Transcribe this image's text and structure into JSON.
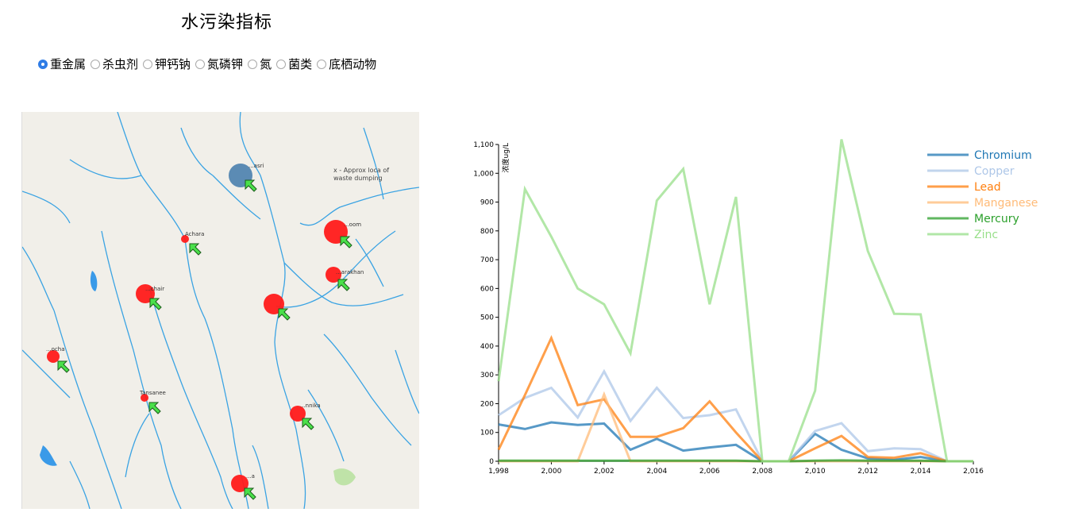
{
  "page": {
    "title": "水污染指标"
  },
  "categories": [
    {
      "label": "重金属",
      "checked": true
    },
    {
      "label": "杀虫剂",
      "checked": false
    },
    {
      "label": "钾钙钠",
      "checked": false
    },
    {
      "label": "氮磷钾",
      "checked": false
    },
    {
      "label": "氮",
      "checked": false
    },
    {
      "label": "菌类",
      "checked": false
    },
    {
      "label": "底栖动物",
      "checked": false
    }
  ],
  "map": {
    "note": "x - Approx loca of waste dumping",
    "towns": [
      {
        "label": "Achara"
      },
      {
        "label": "...chair"
      },
      {
        "label": "...ocha"
      },
      {
        "label": "Tansanee"
      },
      {
        "label": "...arakhan"
      },
      {
        "label": "...oom"
      },
      {
        "label": "...nnika"
      },
      {
        "label": "...asri"
      },
      {
        "label": "...a"
      }
    ],
    "marker_colors": {
      "red": "#ff1a1a",
      "blue": "#4a7fae",
      "arrow": "#4ae04a"
    }
  },
  "chart_data": {
    "type": "line",
    "ylabel": "浓度ug/L",
    "xlim": [
      1998,
      2016
    ],
    "ylim": [
      0,
      1100
    ],
    "x_ticks": [
      "1,998",
      "2,000",
      "2,002",
      "2,004",
      "2,006",
      "2,008",
      "2,010",
      "2,012",
      "2,014",
      "2,016"
    ],
    "y_ticks": [
      "0",
      "100",
      "200",
      "300",
      "400",
      "500",
      "600",
      "700",
      "800",
      "900",
      "1,000",
      "1,100"
    ],
    "legend_position": "top-right",
    "series": [
      {
        "name": "Chromium",
        "color": "#1f77b4",
        "x": [
          1998,
          1999,
          2000,
          2001,
          2002,
          2003,
          2004,
          2005,
          2006,
          2007,
          2008,
          2009,
          2010,
          2011,
          2012,
          2013,
          2014,
          2015,
          2016
        ],
        "values": [
          128,
          112,
          135,
          126,
          131,
          40,
          78,
          37,
          48,
          57,
          0,
          0,
          95,
          40,
          10,
          5,
          15,
          0,
          0
        ]
      },
      {
        "name": "Copper",
        "color": "#aec7e8",
        "x": [
          1998,
          1999,
          2000,
          2001,
          2002,
          2003,
          2004,
          2005,
          2006,
          2007,
          2008,
          2009,
          2010,
          2011,
          2012,
          2013,
          2014,
          2015,
          2016
        ],
        "values": [
          160,
          220,
          255,
          152,
          312,
          140,
          255,
          150,
          160,
          180,
          0,
          0,
          105,
          132,
          35,
          45,
          42,
          0,
          0
        ]
      },
      {
        "name": "Lead",
        "color": "#ff7f0e",
        "x": [
          1998,
          1999,
          2000,
          2001,
          2002,
          2003,
          2004,
          2005,
          2006,
          2007,
          2008,
          2009,
          2010,
          2011,
          2012,
          2013,
          2014,
          2015,
          2016
        ],
        "values": [
          40,
          230,
          428,
          195,
          215,
          85,
          85,
          115,
          208,
          100,
          0,
          0,
          45,
          88,
          15,
          12,
          28,
          0,
          0
        ]
      },
      {
        "name": "Manganese",
        "color": "#ffbb78",
        "x": [
          1998,
          1999,
          2000,
          2001,
          2002,
          2003,
          2004,
          2005,
          2006,
          2007,
          2008,
          2009,
          2010,
          2011,
          2012,
          2013,
          2014,
          2015,
          2016
        ],
        "values": [
          0,
          0,
          0,
          0,
          232,
          0,
          0,
          0,
          0,
          0,
          0,
          0,
          0,
          0,
          0,
          0,
          0,
          0,
          0
        ]
      },
      {
        "name": "Mercury",
        "color": "#2ca02c",
        "x": [
          1998,
          1999,
          2000,
          2001,
          2002,
          2003,
          2004,
          2005,
          2006,
          2007,
          2008,
          2009,
          2010,
          2011,
          2012,
          2013,
          2014,
          2015,
          2016
        ],
        "values": [
          2,
          2,
          2,
          2,
          2,
          2,
          2,
          2,
          2,
          2,
          0,
          0,
          2,
          3,
          2,
          2,
          2,
          0,
          0
        ]
      },
      {
        "name": "Zinc",
        "color": "#98df8a",
        "x": [
          1998,
          1999,
          2000,
          2001,
          2002,
          2003,
          2004,
          2005,
          2006,
          2007,
          2008,
          2009,
          2010,
          2011,
          2012,
          2013,
          2014,
          2015,
          2016
        ],
        "values": [
          278,
          945,
          780,
          600,
          545,
          375,
          905,
          1015,
          545,
          918,
          0,
          0,
          245,
          1118,
          730,
          512,
          510,
          0,
          0
        ]
      }
    ]
  }
}
